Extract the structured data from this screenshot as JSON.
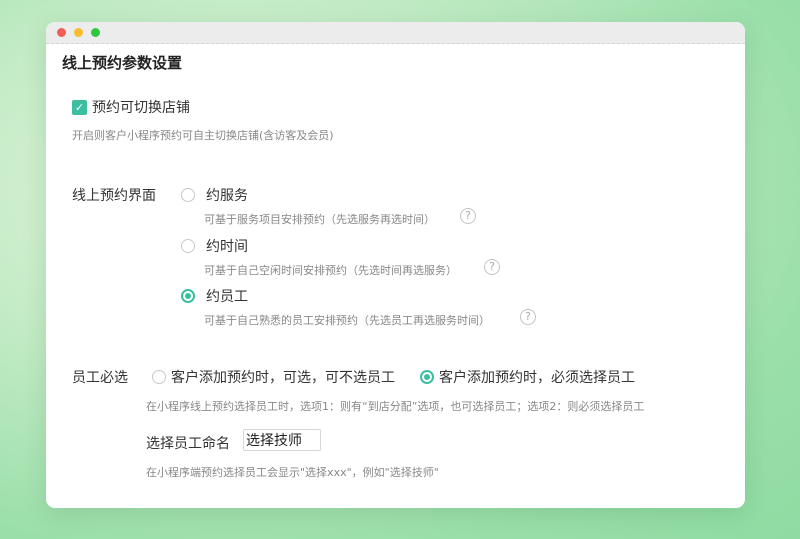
{
  "section_title": "线上预约参数设置",
  "switch_store": {
    "label": "预约可切换店铺",
    "checked": true,
    "hint": "开启则客户小程序预约可自主切换店铺(含访客及会员)"
  },
  "booking_interface": {
    "label": "线上预约界面",
    "options": [
      {
        "label": "约服务",
        "hint": "可基于服务项目安排预约（先选服务再选时间）",
        "selected": false
      },
      {
        "label": "约时间",
        "hint": "可基于自己空闲时间安排预约（先选时间再选服务）",
        "selected": false
      },
      {
        "label": "约员工",
        "hint": "可基于自己熟悉的员工安排预约（先选员工再选服务时间）",
        "selected": true
      }
    ],
    "help_glyph": "?"
  },
  "staff_required": {
    "label": "员工必选",
    "options": [
      {
        "label": "客户添加预约时，可选，可不选员工",
        "selected": false
      },
      {
        "label": "客户添加预约时，必须选择员工",
        "selected": true
      }
    ],
    "hint": "在小程序线上预约选择员工时，选项1：则有“到店分配”选项，也可选择员工；选项2：则必须选择员工"
  },
  "staff_naming": {
    "label": "选择员工命名",
    "value": "选择技师",
    "hint": "在小程序端预约选择员工会显示\"选择xxx\"，例如\"选择技师\""
  },
  "colors": {
    "accent": "#3cbea0"
  }
}
